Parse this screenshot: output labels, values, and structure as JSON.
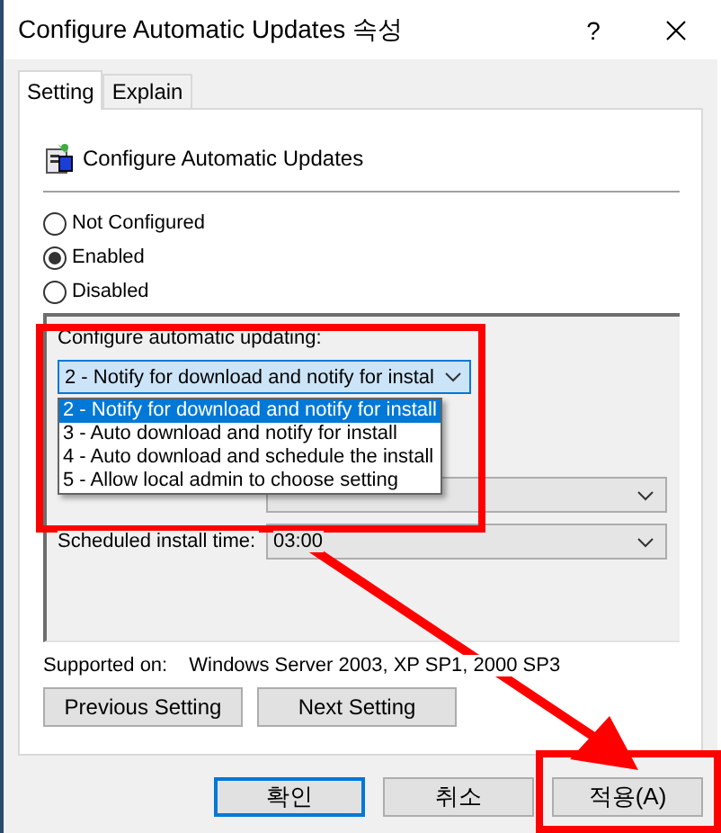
{
  "window": {
    "title": "Configure Automatic Updates 속성",
    "help": "?"
  },
  "tabs": [
    {
      "label": "Setting",
      "selected": true
    },
    {
      "label": "Explain",
      "selected": false
    }
  ],
  "policy": {
    "title": "Configure Automatic Updates"
  },
  "options": [
    {
      "label": "Not Configured",
      "selected": false
    },
    {
      "label": "Enabled",
      "selected": true
    },
    {
      "label": "Disabled",
      "selected": false
    }
  ],
  "updating": {
    "label": "Configure automatic updating:",
    "value": "2 - Notify for download and notify for instal",
    "expanded": true,
    "items": [
      {
        "label": "2 - Notify for download and notify for install",
        "selected": true
      },
      {
        "label": "3 - Auto download and notify for install",
        "selected": false
      },
      {
        "label": "4 - Auto download and schedule the install",
        "selected": false
      },
      {
        "label": "5 - Allow local admin to choose setting",
        "selected": false
      }
    ]
  },
  "fields": [
    {
      "kind": "covered"
    },
    {
      "kind": "field",
      "label": "Scheduled install time:",
      "value": "03:00"
    }
  ],
  "supported": {
    "label": "Supported on:",
    "value": "Windows Server 2003, XP SP1, 2000 SP3"
  },
  "nav_buttons": [
    "Previous Setting",
    "Next Setting"
  ],
  "dialog_buttons": [
    {
      "label": "확인",
      "default": true
    },
    {
      "label": "취소",
      "default": false
    },
    {
      "label": "적용(A)",
      "default": false
    }
  ]
}
